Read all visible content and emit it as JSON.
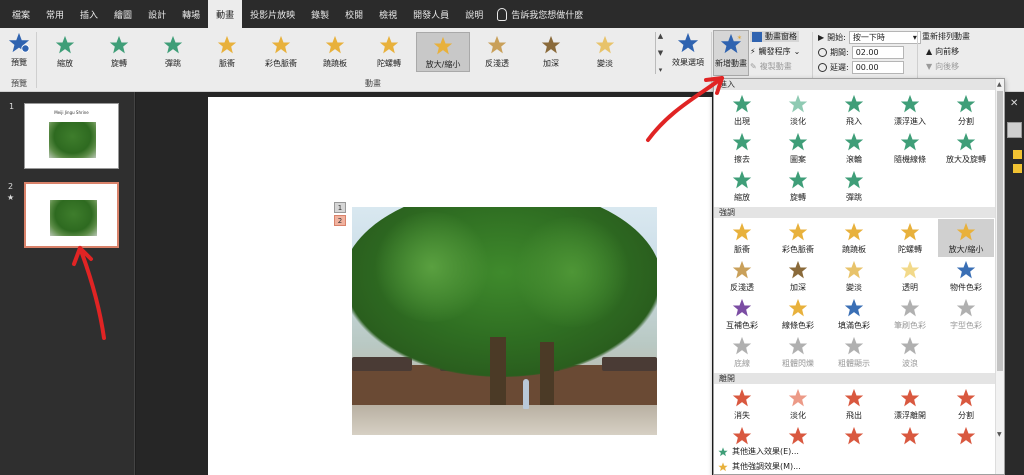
{
  "tabs": [
    "檔案",
    "常用",
    "插入",
    "繪圖",
    "設計",
    "轉場",
    "動畫",
    "投影片放映",
    "錄製",
    "校閱",
    "檢視",
    "開發人員",
    "說明"
  ],
  "active_tab_index": 6,
  "tell_me": "告訴我您想做什麼",
  "ribbon": {
    "preview": {
      "label": "預覽",
      "group": "預覽"
    },
    "gallery": [
      {
        "label": "縮放",
        "color": "#3f9e78"
      },
      {
        "label": "旋轉",
        "color": "#3f9e78"
      },
      {
        "label": "彈跳",
        "color": "#3f9e78"
      },
      {
        "label": "脈衝",
        "color": "#e8b13c"
      },
      {
        "label": "彩色脈衝",
        "color": "#e8b13c"
      },
      {
        "label": "蹺蹺板",
        "color": "#e8b13c"
      },
      {
        "label": "陀螺轉",
        "color": "#e8b13c"
      },
      {
        "label": "放大/縮小",
        "color": "#e8b13c"
      },
      {
        "label": "反淺透",
        "color": "#c9a05a"
      },
      {
        "label": "加深",
        "color": "#8a6a3a"
      },
      {
        "label": "變淡",
        "color": "#e8c36a"
      }
    ],
    "selected_gallery_index": 7,
    "effect_options": "效果選項",
    "group_animation": "動畫",
    "add_animation": "新增動畫",
    "animation_pane": "動畫窗格",
    "trigger": "觸發程序",
    "animation_painter": "複製動畫",
    "start_label": "開始:",
    "start_value": "按一下時",
    "duration_label": "期間:",
    "duration_value": "02.00",
    "delay_label": "延遲:",
    "delay_value": "00.00",
    "reorder_title": "重新排列動畫",
    "move_earlier": "向前移",
    "move_later": "向後移"
  },
  "slides": [
    {
      "number": "1",
      "title": "Meiji Jingu Shrine"
    },
    {
      "number": "2",
      "mark": "★"
    }
  ],
  "anim_tags": [
    "1",
    "2"
  ],
  "panel": {
    "sections": [
      {
        "title": "進入",
        "items": [
          {
            "label": "出現",
            "color": "#3f9e78"
          },
          {
            "label": "淡化",
            "color": "#8fcab3"
          },
          {
            "label": "飛入",
            "color": "#3f9e78"
          },
          {
            "label": "漂浮進入",
            "color": "#3f9e78"
          },
          {
            "label": "分割",
            "color": "#3f9e78"
          },
          {
            "label": "擦去",
            "color": "#3f9e78"
          },
          {
            "label": "圖案",
            "color": "#3f9e78"
          },
          {
            "label": "滾輪",
            "color": "#3f9e78"
          },
          {
            "label": "隨機線條",
            "color": "#3f9e78"
          },
          {
            "label": "放大及旋轉",
            "color": "#3f9e78"
          },
          {
            "label": "縮放",
            "color": "#3f9e78"
          },
          {
            "label": "旋轉",
            "color": "#3f9e78"
          },
          {
            "label": "彈跳",
            "color": "#3f9e78"
          }
        ]
      },
      {
        "title": "強調",
        "items": [
          {
            "label": "脈衝",
            "color": "#e8b13c"
          },
          {
            "label": "彩色脈衝",
            "color": "#e8b13c"
          },
          {
            "label": "蹺蹺板",
            "color": "#e8b13c"
          },
          {
            "label": "陀螺轉",
            "color": "#e8b13c"
          },
          {
            "label": "放大/縮小",
            "color": "#e8b13c"
          },
          {
            "label": "反淺透",
            "color": "#c9a05a"
          },
          {
            "label": "加深",
            "color": "#8a6a3a"
          },
          {
            "label": "變淡",
            "color": "#e8c36a"
          },
          {
            "label": "透明",
            "color": "#f2d98a"
          },
          {
            "label": "物件色彩",
            "color": "#3a6fb5"
          },
          {
            "label": "互補色彩",
            "color": "#7b4da3"
          },
          {
            "label": "線條色彩",
            "color": "#e8b13c"
          },
          {
            "label": "填滿色彩",
            "color": "#3a6fb5"
          },
          {
            "label": "筆刷色彩",
            "color": "#b0b0b0"
          },
          {
            "label": "字型色彩",
            "color": "#b0b0b0"
          },
          {
            "label": "底線",
            "color": "#b0b0b0"
          },
          {
            "label": "粗體閃爍",
            "color": "#b0b0b0"
          },
          {
            "label": "粗體顯示",
            "color": "#b0b0b0"
          },
          {
            "label": "波浪",
            "color": "#b0b0b0"
          }
        ]
      },
      {
        "title": "離開",
        "items": [
          {
            "label": "消失",
            "color": "#d9583f"
          },
          {
            "label": "淡化",
            "color": "#ec9a87"
          },
          {
            "label": "飛出",
            "color": "#d9583f"
          },
          {
            "label": "漂浮離開",
            "color": "#d9583f"
          },
          {
            "label": "分割",
            "color": "#d9583f"
          },
          {
            "label": "",
            "color": "#d9583f"
          },
          {
            "label": "",
            "color": "#d9583f"
          },
          {
            "label": "",
            "color": "#d9583f"
          },
          {
            "label": "",
            "color": "#d9583f"
          },
          {
            "label": "",
            "color": "#d9583f"
          }
        ]
      }
    ],
    "selected_emphasis_index": 4,
    "more_entrance": "其他進入效果(E)...",
    "more_emphasis": "其他強調效果(M)..."
  },
  "colors": {
    "accent": "#d9826a",
    "arrow": "#e02424",
    "ribbon_bg": "#ececec",
    "tab_bar": "#2b2b2b"
  }
}
